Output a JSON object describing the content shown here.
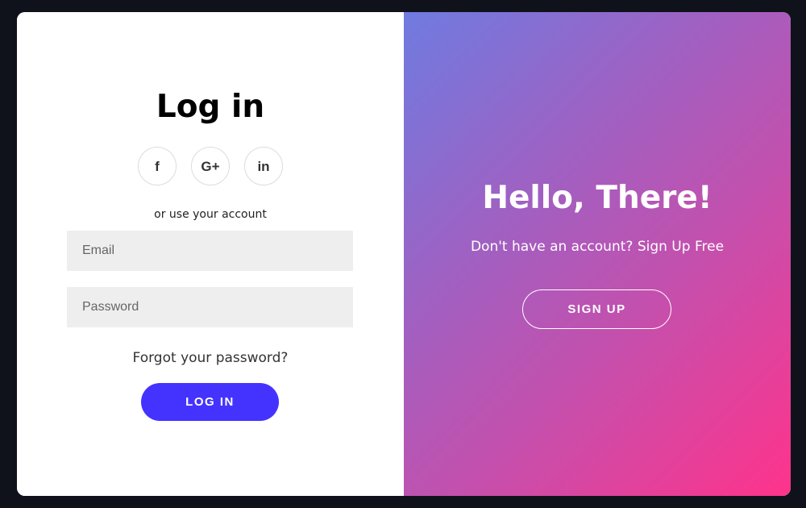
{
  "login": {
    "title": "Log in",
    "social": [
      {
        "name": "facebook-icon",
        "glyph": "f"
      },
      {
        "name": "google-plus-icon",
        "glyph": "G+"
      },
      {
        "name": "linkedin-icon",
        "glyph": "in"
      }
    ],
    "or_text": "or use your account",
    "email_placeholder": "Email",
    "password_placeholder": "Password",
    "forgot_text": "Forgot your password?",
    "button_label": "LOG IN"
  },
  "signup_panel": {
    "title": "Hello, There!",
    "text": "Don't have an account? Sign Up Free",
    "button_label": "SIGN UP"
  },
  "colors": {
    "accent": "#4433ff",
    "background": "#0f121a",
    "gradient_start": "#6f7be0",
    "gradient_end": "#ff338b",
    "field_bg": "#eeeeee"
  }
}
